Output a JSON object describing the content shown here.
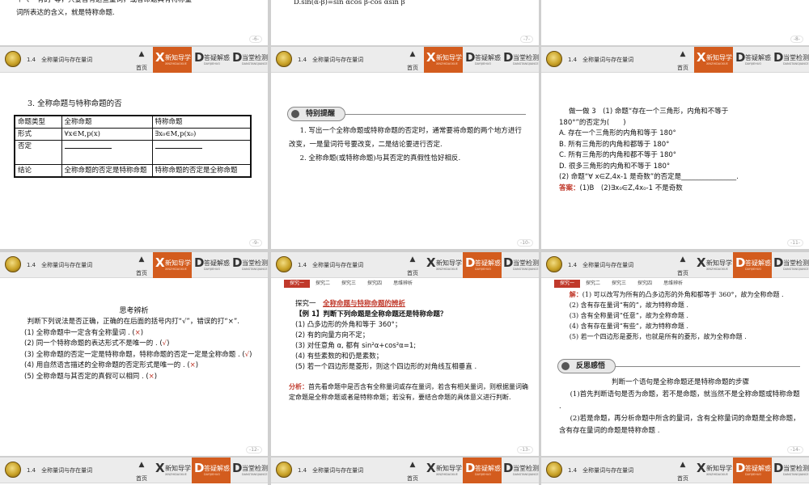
{
  "header": {
    "section": "1.4　全称量词与存在量词",
    "home": "首页",
    "tab1": {
      "letter": "X",
      "label": "新知导学",
      "en": "XINZHIDAOXUE"
    },
    "tab2": {
      "letter": "D",
      "label": "答疑解惑",
      "en": "DAYIJIEHUO"
    },
    "tab3": {
      "letter": "D",
      "label": "当堂检测",
      "en": "DANGTANGJIANCE"
    }
  },
  "explore_tabs": [
    "探究一",
    "探究二",
    "探究三",
    "探究四",
    "思维辨析"
  ],
  "slides": {
    "s6": {
      "page": "-6-",
      "line1": "个”、“有的”等，只要含有这些量词，或者命题具有特称量",
      "line2": "词所表达的含义，就是特称命题."
    },
    "s7": {
      "page": "-7-",
      "line1": "D.sin(α-β)=sin αcos β-cos αsin β"
    },
    "s8": {
      "page": "-8-",
      "line1": ""
    },
    "s9": {
      "page": "-9-",
      "title": "3. 全称命题与特称命题的否",
      "table": {
        "h": [
          "命题类型",
          "全称命题",
          "特称命题"
        ],
        "r1": [
          "形式",
          "∀x∈M,p(x)",
          "∃x₀∈M,p(x₀)"
        ],
        "r2": [
          "否定",
          "",
          ""
        ],
        "r3": [
          "结论",
          "全称命题的否定是特称命题",
          "特称命题的否定是全称命题"
        ]
      }
    },
    "s10": {
      "page": "-10-",
      "pill": "特别提醒",
      "p1": "1. 写出一个全称命题或特称命题的否定时，通常要将命题的两个地方进行改变，一是量词符号要改变，二是结论要进行否定.",
      "p2": "2. 全称命题(或特称命题)与其否定的真假性恰好相反."
    },
    "s11": {
      "page": "-11-",
      "q1": "做一做 3　(1) 命题“存在一个三角形，内角和不等于",
      "q1b": "180°”的否定为(　　)",
      "A": "A. 存在一个三角形的内角和等于 180°",
      "B": "B. 所有三角形的内角和都等于 180°",
      "C": "C. 所有三角形的内角和都不等于 180°",
      "D": "D. 很多三角形的内角和不等于 180°",
      "q2": "(2) 命题“∀ x∈Z,4x-1 是奇数”的否定是________________.",
      "ans_label": "答案：",
      "ans": "(1)B　(2)∃x₀∈Z,4x₀-1 不是奇数"
    },
    "s12": {
      "page": "-12-",
      "title": "思考辨析",
      "intro": "判断下列说法是否正确，正确的在后面的括号内打“√”，错误的打“×”.",
      "items": [
        {
          "t": "(1) 全称命题中一定含有全称量词 . (",
          "m": "×",
          "e": ")"
        },
        {
          "t": "(2) 同一个特称命题的表达形式不是唯一的 . (",
          "m": "√",
          "e": ")"
        },
        {
          "t": "(3) 全称命题的否定一定是特称命题，特称命题的否定一定是全称命题 . (",
          "m": "√",
          "e": ")"
        },
        {
          "t": "(4) 用自然语言描述的全称命题的否定形式是唯一的 . (",
          "m": "×",
          "e": ")"
        },
        {
          "t": "(5) 全称命题与其否定的真假可以相同 . (",
          "m": "×",
          "e": ")"
        }
      ]
    },
    "s13": {
      "page": "-13-",
      "head1": "探究一　",
      "head2": "全称命题与特称命题的辨析",
      "ex": "【例 1】判断下列命题是全称命题还是特称命题？",
      "i1": "(1) 凸多边形的外角和等于 360°；",
      "i2": "(2) 有的向量方向不定；",
      "i3": "(3) 对任意角 α, 都有 sin²α+cos²α=1;",
      "i4": "(4) 有些素数的和仍是素数；",
      "i5": "(5) 若一个四边形是菱形，则这个四边形的对角线互相垂直 .",
      "an_label": "分析：",
      "an": "首先看命题中是否含有全称量词或存在量词，若含有相关量词，则根据量词确定命题是全称命题或者是特称命题；若没有，要结合命题的具体意义进行判断."
    },
    "s14": {
      "page": "-14-",
      "sol_label": "解：",
      "s1": "(1) 可以改写为所有的凸多边形的外角和都等于 360°，故为全称命题 .",
      "s2": "(2) 含有存在量词“有的”，故为特称命题 .",
      "s3": "(3) 含有全称量词“任意”，故为全称命题 .",
      "s4": "(4) 含有存在量词“有些”，故为特称命题 .",
      "s5": "(5) 若一个四边形是菱形，也就是所有的菱形，故为全称命题 .",
      "pill": "反思感悟",
      "rt": "判断一个语句是全称命题还是特称命题的步骤",
      "r1": "(1)首先判断语句是否为命题，若不是命题，就当然不是全称命题或特称命题 .",
      "r2": "(2)若是命题，再分析命题中所含的量词，含有全称量词的命题是全称命题，含有存在量词的命题是特称命题 ."
    }
  }
}
